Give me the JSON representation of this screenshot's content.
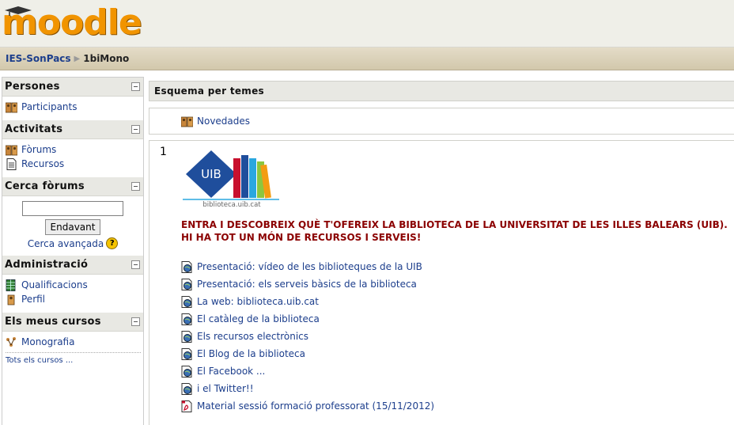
{
  "header": {
    "logo_text": "moodle"
  },
  "breadcrumb": {
    "home": "IES-SonPacs",
    "separator": "▶",
    "current": "1biMono"
  },
  "blocks": {
    "people": {
      "title": "Persones",
      "items": [
        "Participants"
      ]
    },
    "activities": {
      "title": "Activitats",
      "items": [
        "Fòrums",
        "Recursos"
      ]
    },
    "search": {
      "title": "Cerca fòrums",
      "input_value": "",
      "button_label": "Endavant",
      "advanced_label": "Cerca avançada",
      "help_glyph": "?"
    },
    "admin": {
      "title": "Administració",
      "items": [
        "Qualificacions",
        "Perfil"
      ]
    },
    "courses": {
      "title": "Els meus cursos",
      "items": [
        "Monografia"
      ],
      "all_label": "Tots els cursos ..."
    }
  },
  "main": {
    "title": "Esquema per temes",
    "section0": {
      "item": "Novedades"
    },
    "section1": {
      "number": "1",
      "logo": {
        "badge_text": "UIB",
        "caption": "biblioteca.uib.cat"
      },
      "announcement_line1": "ENTRA I DESCOBREIX QUÈ T'OFEREIX LA BIBLIOTECA DE LA UNIVERSITAT DE LES ILLES BALEARS (UIB).",
      "announcement_line2": "HI HA TOT UN MÓN DE RECURSOS I SERVEIS!",
      "resources": [
        "Presentació: vídeo de les biblioteques de la UIB",
        "Presentació: els serveis bàsics de la biblioteca",
        "La web: biblioteca.uib.cat",
        "El catàleg de la biblioteca",
        "Els recursos electrònics",
        "El Blog de la biblioteca",
        "El Facebook ...",
        "i el Twitter!!",
        "Material sessió formació professorat (15/11/2012)"
      ]
    }
  },
  "colors": {
    "link": "#1c3e8c",
    "announcement": "#8b0000",
    "logo_orange": "#f19400",
    "uib_blue": "#1f4e9c"
  }
}
